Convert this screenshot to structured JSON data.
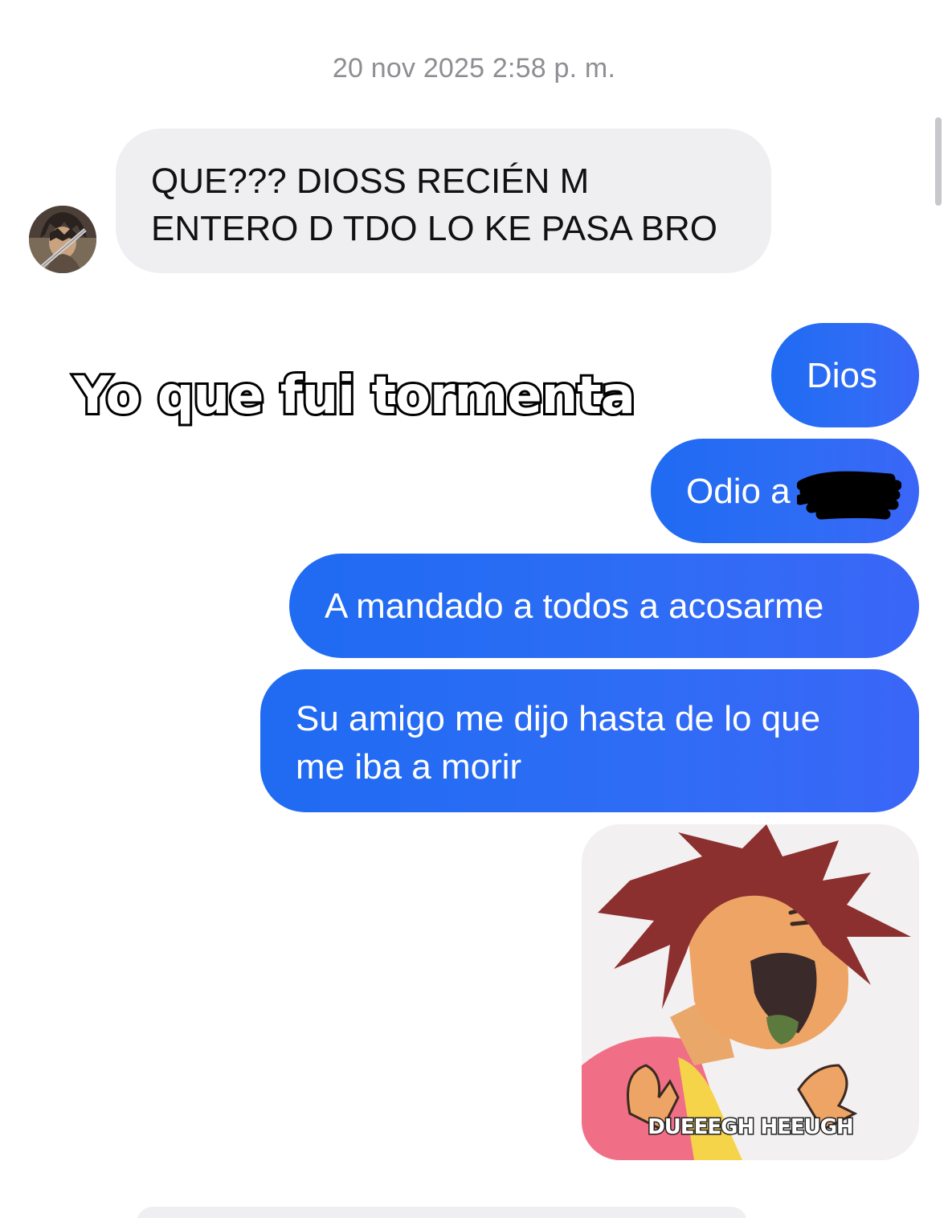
{
  "timestamp": "20 nov 2025 2:58 p. m.",
  "incoming_message": {
    "line1": "QUE??? DIOSS RECIÉN M",
    "line2": "ENTERO D TDO LO KE PASA BRO"
  },
  "outgoing_messages": [
    {
      "lines": [
        "Dios"
      ]
    },
    {
      "lines": [
        "Odio a"
      ]
    },
    {
      "lines": [
        "A mandado a todos a acosarme"
      ]
    },
    {
      "lines": [
        "Su amigo me dijo hasta de lo que",
        "me iba a morir"
      ]
    }
  ],
  "overlay_caption": "Yo que fui tormenta",
  "sticker": {
    "caption": "DUEEEGH HEEUGH"
  },
  "colors": {
    "outgoing_bubble": "#2f6cf5",
    "incoming_bubble": "#efeff1",
    "timestamp": "#8e8e93"
  },
  "icons": {
    "avatar": "user-avatar",
    "redaction": "redaction-scribble"
  }
}
